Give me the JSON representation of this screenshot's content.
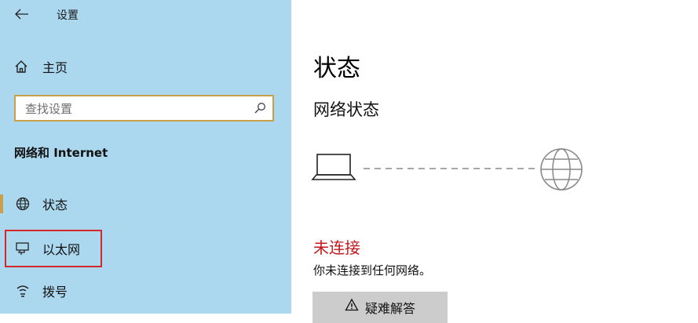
{
  "header": {
    "title": "设置"
  },
  "sidebar": {
    "home_label": "主页",
    "search": {
      "placeholder": "查找设置",
      "value": ""
    },
    "section_title": "网络和 Internet",
    "items": [
      {
        "label": "状态",
        "icon": "globe-icon",
        "selected": true
      },
      {
        "label": "以太网",
        "icon": "ethernet-monitor-icon",
        "highlighted": true
      },
      {
        "label": "拨号",
        "icon": "dialup-icon"
      }
    ]
  },
  "main": {
    "page_title": "状态",
    "network_status_title": "网络状态",
    "diagram": {
      "left_icon": "laptop-icon",
      "right_icon": "globe-icon",
      "connected": false
    },
    "status_text": "未连接",
    "status_desc": "你未连接到任何网络。",
    "troubleshoot_label": "疑难解答",
    "troubleshoot_icon": "warning-icon"
  },
  "colors": {
    "sidebar_bg": "#abd8ef",
    "accent": "#c8a04a",
    "error_red": "#c4161c",
    "highlight_red": "#d4282a",
    "button_bg": "#cccccc"
  }
}
